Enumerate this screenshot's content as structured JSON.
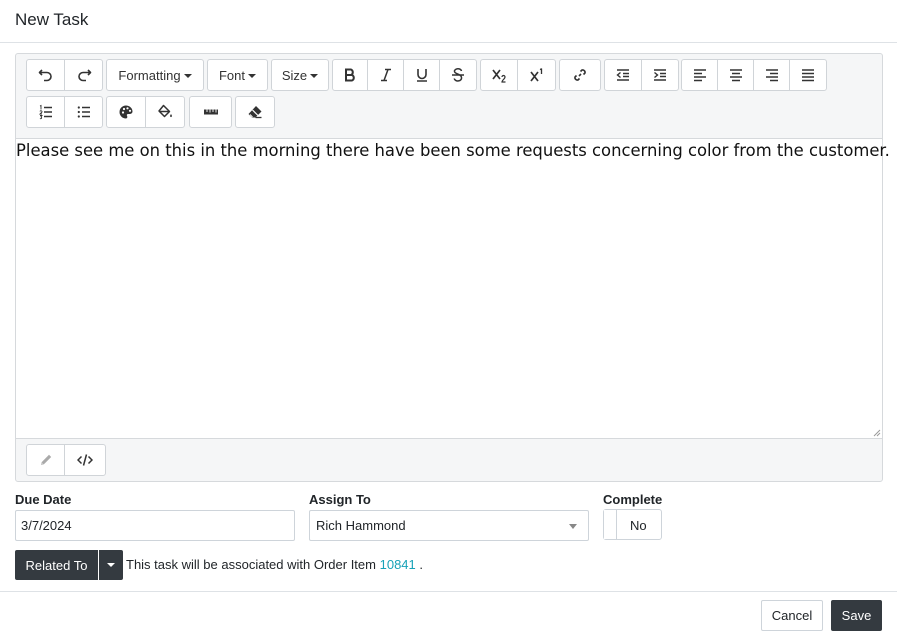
{
  "modal": {
    "title": "New Task"
  },
  "toolbar": {
    "formatting_label": "Formatting",
    "font_label": "Font",
    "size_label": "Size",
    "icons": [
      "undo-icon",
      "redo-icon",
      "bold-icon",
      "italic-icon",
      "underline-icon",
      "strikethrough-icon",
      "subscript-icon",
      "superscript-icon",
      "link-icon",
      "outdent-icon",
      "indent-icon",
      "align-left-icon",
      "align-center-icon",
      "align-right-icon",
      "justify-icon",
      "ordered-list-icon",
      "unordered-list-icon",
      "text-color-icon",
      "background-color-icon",
      "horizontal-rule-icon",
      "clear-formatting-icon"
    ]
  },
  "editor": {
    "content": "Please see me on this in the morning there have been some requests concerning color from the customer.",
    "statusbar_icons": [
      "pencil-icon",
      "code-view-icon"
    ]
  },
  "form": {
    "due_date_label": "Due Date",
    "due_date_value": "3/7/2024",
    "assign_to_label": "Assign To",
    "assign_to_value": "Rich Hammond",
    "complete_label": "Complete",
    "complete_value": "No"
  },
  "related": {
    "button_label": "Related To",
    "text_before": "This task will be associated with Order Item",
    "link_text": "10841",
    "text_after": "."
  },
  "footer": {
    "cancel_label": "Cancel",
    "save_label": "Save"
  },
  "colors": {
    "dark_button": "#343a40",
    "link": "#17a2b8",
    "toolbar_bg": "#f5f6f7",
    "border": "#ced4da"
  }
}
